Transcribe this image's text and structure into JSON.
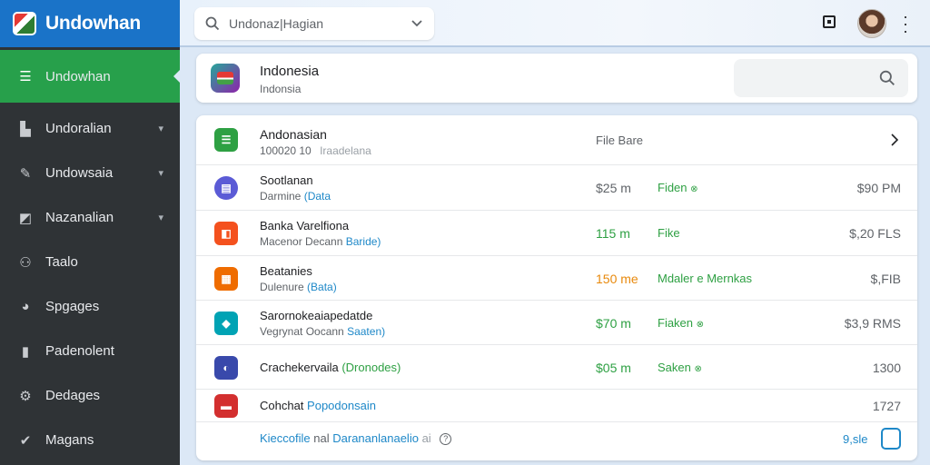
{
  "colors": {
    "brand": "#1a73c8",
    "active": "#27a04b",
    "sidebar": "#2f3336",
    "green": "#2ea043",
    "orange": "#e8890c",
    "link": "#1e88c8"
  },
  "app": {
    "title": "Undowhan"
  },
  "sidebar": {
    "items": [
      {
        "label": "Undowhan",
        "icon": "list-icon",
        "active": true,
        "chevron": false
      },
      {
        "label": "Undoralian",
        "icon": "briefcase-icon",
        "chevron": true
      },
      {
        "label": "Undowsaia",
        "icon": "tool-icon",
        "chevron": true
      },
      {
        "label": "Nazanalian",
        "icon": "image-icon",
        "chevron": true
      },
      {
        "label": "Taalo",
        "icon": "users-icon",
        "chevron": false
      },
      {
        "label": "Spgages",
        "icon": "chat-icon",
        "chevron": false
      },
      {
        "label": "Padenolent",
        "icon": "bar-chart-icon",
        "chevron": false
      },
      {
        "label": "Dedages",
        "icon": "gear-icon",
        "chevron": false
      },
      {
        "label": "Magans",
        "icon": "check-circle-icon",
        "chevron": false
      }
    ]
  },
  "search": {
    "value": "Undonaz|Hagian"
  },
  "header": {
    "title": "Indonesia",
    "subtitle": "Indonsia"
  },
  "list": {
    "head": {
      "title": "Andonasian",
      "subtitle": "100020 10",
      "subtitle_tag": "Iraadelana",
      "column": "File Bare"
    },
    "rows": [
      {
        "title": "Sootlanan",
        "sub": "Darmine",
        "tag": "(Data",
        "amount": "$25 m",
        "status": "Fiden",
        "right": "$90 PM",
        "icon_color": "#5b5bd6",
        "icon_glyph": "▤",
        "amount_color": "#5f6368",
        "status_color": "#2ea043",
        "status_icon": "⊗"
      },
      {
        "title": "Banka Varelfiona",
        "sub": "Macenor Decann",
        "tag": "Baride)",
        "amount": "115 m",
        "status": "Fike",
        "right": "$,20 FLS",
        "icon_color": "#f4511e",
        "icon_glyph": "◧",
        "amount_color": "#2ea043",
        "status_color": "#2ea043",
        "status_icon": ""
      },
      {
        "title": "Beatanies",
        "sub": "Dulenure",
        "tag": "(Bata)",
        "amount": "150 me",
        "status": "Mdaler e Mernkas",
        "right": "$,FIB",
        "icon_color": "#ef6c00",
        "icon_glyph": "▦",
        "amount_color": "#e8890c",
        "status_color": "#2ea043",
        "status_icon": ""
      },
      {
        "title": "Sarornokeaiapedatde",
        "sub": "Vegrynat Oocann",
        "tag": "Saaten)",
        "amount": "$70 m",
        "status": "Fiaken",
        "right": "$3,9 RMS",
        "icon_color": "#00a3b4",
        "icon_glyph": "◆",
        "amount_color": "#2ea043",
        "status_color": "#2ea043",
        "status_icon": "⊗"
      },
      {
        "title": "Crachekervaila",
        "sub": "",
        "tag": "(Dronodes)",
        "amount": "$05 m",
        "status": "Saken",
        "right": "1300",
        "icon_color": "#3949ab",
        "icon_glyph": "◐",
        "amount_color": "#2ea043",
        "status_color": "#2ea043",
        "status_icon": "⊗"
      },
      {
        "title": "Cohchat",
        "sub": "",
        "tag": "Popodonsain",
        "amount": "",
        "status": "",
        "right": "1727",
        "icon_color": "#d32f2f",
        "icon_glyph": "▬",
        "amount_color": "#2ea043",
        "status_color": "#2ea043",
        "status_icon": ""
      }
    ],
    "footer": {
      "link_a": "Kieccofile",
      "link_mid": "nal",
      "link_b": "Darananlanaelio",
      "link_tail": "ai",
      "value": "9,sle"
    }
  }
}
